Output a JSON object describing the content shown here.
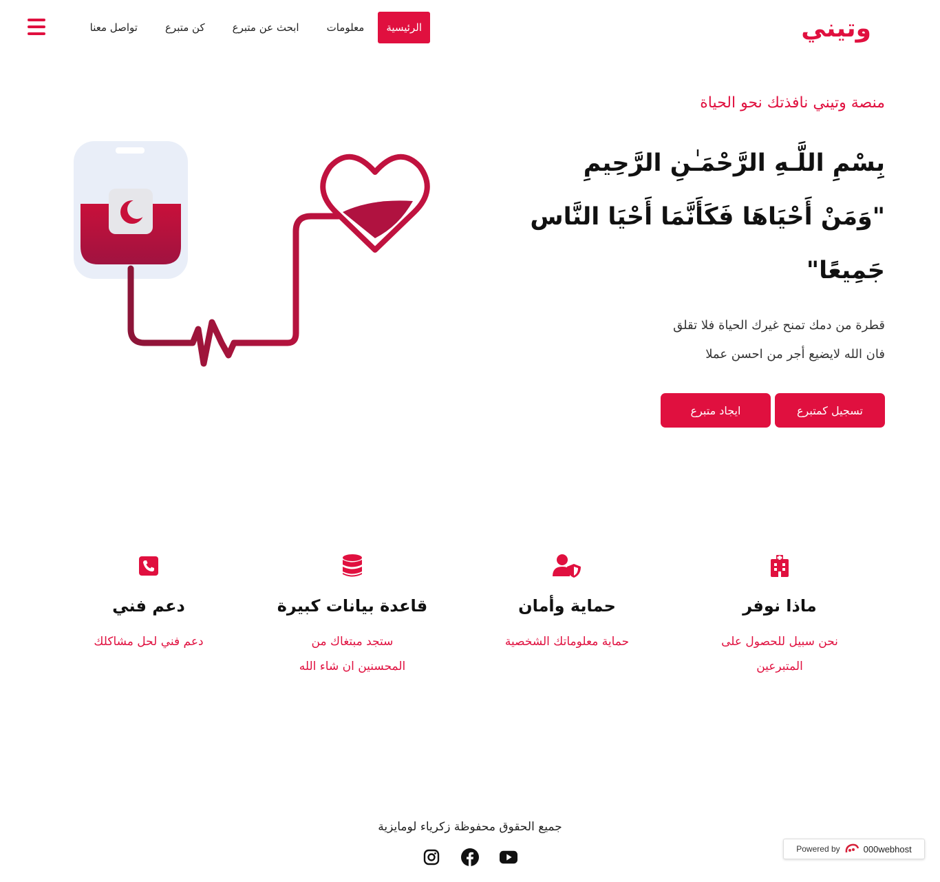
{
  "brand": {
    "logo_text": "وتيني",
    "accent": "#e0103f"
  },
  "nav": {
    "items": [
      {
        "label": "الرئيسية",
        "active": true
      },
      {
        "label": "معلومات",
        "active": false
      },
      {
        "label": "ابحث عن متبرع",
        "active": false
      },
      {
        "label": "كن متبرع",
        "active": false
      },
      {
        "label": "تواصل معنا",
        "active": false
      }
    ],
    "menu_icon": "hamburger-icon"
  },
  "hero": {
    "tagline": "منصة وتيني نافذتك نحو الحياة",
    "verse_line1": "بِسْمِ اللَّـهِ الرَّحْمَـٰنِ الرَّحِيمِ",
    "verse_line2": "\"وَمَنْ أَحْيَاهَا فَكَأَنَّمَا أَحْيَا النَّاس",
    "verse_line3": "جَمِيعًا\"",
    "desc_line1": "قطرة من دمك تمنح غيرك الحياة فلا تقلق",
    "desc_line2": "فان الله لايضيع أجر من احسن عملا",
    "register_button": "تسجيل كمتبرع",
    "find_button": "ايجاد متبرع"
  },
  "features": [
    {
      "icon": "hospital-icon",
      "title": "ماذا نوفر",
      "line1": "نحن سبيل للحصول على",
      "line2": "المتبرعين"
    },
    {
      "icon": "user-shield-icon",
      "title": "حماية وأمان",
      "line1": "حماية معلوماتك الشخصية",
      "line2": ""
    },
    {
      "icon": "database-icon",
      "title": "قاعدة بيانات كبيرة",
      "line1": "ستجد مبتغاك من",
      "line2": "المحسنين ان شاء الله"
    },
    {
      "icon": "phone-icon",
      "title": "دعم فني",
      "line1": "دعم فني لحل مشاكلك",
      "line2": ""
    }
  ],
  "footer": {
    "copyright": "جميع الحقوق محفوظة زكرياء لومايزية",
    "socials": [
      "instagram-icon",
      "facebook-icon",
      "youtube-icon"
    ]
  },
  "hosting_badge": {
    "prefix": "Powered by",
    "brand": "000webhost"
  }
}
